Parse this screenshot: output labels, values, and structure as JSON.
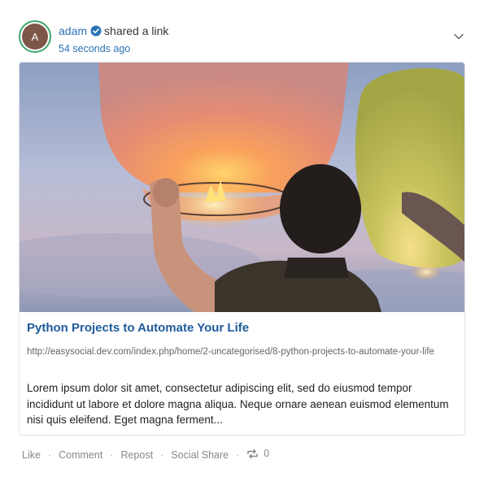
{
  "post": {
    "author": "adam",
    "avatar_initial": "A",
    "action": "shared a link",
    "timestamp": "54 seconds ago"
  },
  "link": {
    "title": "Python Projects to Automate Your Life",
    "url": "http://easysocial.dev.com/index.php/home/2-uncategorised/8-python-projects-to-automate-your-life",
    "description": "Lorem ipsum dolor sit amet, consectetur adipiscing elit, sed do eiusmod tempor incididunt ut labore et dolore magna aliqua. Neque ornare aenean euismod elementum nisi quis eleifend. Eget magna ferment..."
  },
  "actions": {
    "like": "Like",
    "comment": "Comment",
    "repost": "Repost",
    "social_share": "Social Share",
    "repost_count": "0"
  },
  "colors": {
    "accent": "#2b73b6",
    "link_title": "#1e5a9c",
    "avatar_bg": "#7d5648",
    "avatar_ring": "#3ea66b"
  },
  "icons": {
    "verified": "verified-badge-icon",
    "menu": "chevron-down-icon",
    "repost": "repost-icon"
  }
}
